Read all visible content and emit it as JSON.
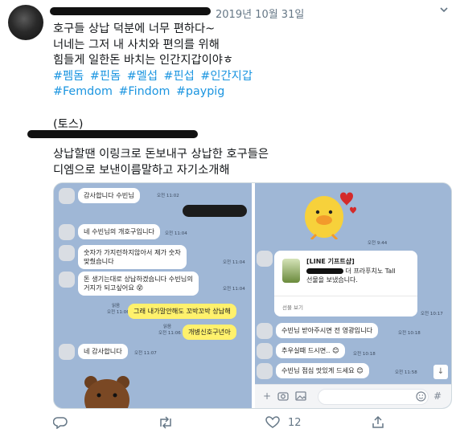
{
  "tweet": {
    "date": "2019년 10월 31일",
    "lines": [
      "호구들 상납 덕분에 너무 편하다~",
      "너네는 그저 내 사치와 편의를 위해",
      "힘들게 일한돈 바치는 인간지갑이야ㅎ"
    ],
    "hashtags_row1": [
      "#펨돔",
      "#핀돔",
      "#멜섭",
      "#핀섭",
      "#인간지갑"
    ],
    "hashtags_row2": [
      "#Femdom",
      "#Findom",
      "#paypig"
    ]
  },
  "quote": {
    "label": "(토스)",
    "line1": "상납할땐 이링크로 돈보내구 상납한 호구들은",
    "line2": "디엠으로 보낸이름말하고 자기소개해"
  },
  "chat_left": {
    "messages": [
      {
        "text": "감사합니다 수빈님",
        "time": "오전 11:02",
        "mine": false
      },
      {
        "text": "네 수빈님의 개호구입니다",
        "time": "오전 11:04",
        "mine": false
      },
      {
        "text": "숫자가 가지런하지않아서 제가 숫자",
        "text2": "맞췄습니다",
        "time": "오전 11:04",
        "mine": false
      },
      {
        "text": "돈 생기는대로 상납하겠습니다 수빈님의",
        "text2": "거지가 되고싶어요",
        "time": "오전 11:04",
        "mine": false
      },
      {
        "text": "그래 내가말안해도 꼬박꼬박 상납해",
        "time": "오전 11:06",
        "read": "읽음",
        "mine": true
      },
      {
        "text": "개병신호구년아",
        "time": "오전 11:06",
        "read": "읽음",
        "mine": true
      },
      {
        "text": "네 감사합니다",
        "time": "오전 11:07",
        "mine": false
      }
    ]
  },
  "chat_right": {
    "sticker_time": "오전 9:44",
    "gift": {
      "title": "[LINE 기프트샵]",
      "line1": "더 프라푸치노 Tall",
      "line2": "선물을 보냈습니다.",
      "button": "선물 보기",
      "time": "오전 10:17"
    },
    "messages": [
      {
        "text": "수빈님 받아주시면 전 영광입니다",
        "time": "오전 10:18"
      },
      {
        "text": "추우실때 드시면..",
        "time": "오전 10:18"
      },
      {
        "text": "수빈님 점심 맛있게 드세요",
        "time": "오전 11:58"
      }
    ]
  },
  "actions": {
    "reply_count": "",
    "retweet_count": "",
    "like_count": "12"
  },
  "icons": [
    "caret-down-icon",
    "reply-icon",
    "retweet-icon",
    "like-icon",
    "share-icon",
    "plus-icon",
    "camera-icon",
    "image-icon",
    "emoji-icon",
    "hash-icon",
    "scroll-down-icon"
  ],
  "colors": {
    "hashtag": "#1b95e0",
    "chat_bg": "#9fb7d6",
    "my_bubble": "#fff16c",
    "meta": "#657786"
  }
}
